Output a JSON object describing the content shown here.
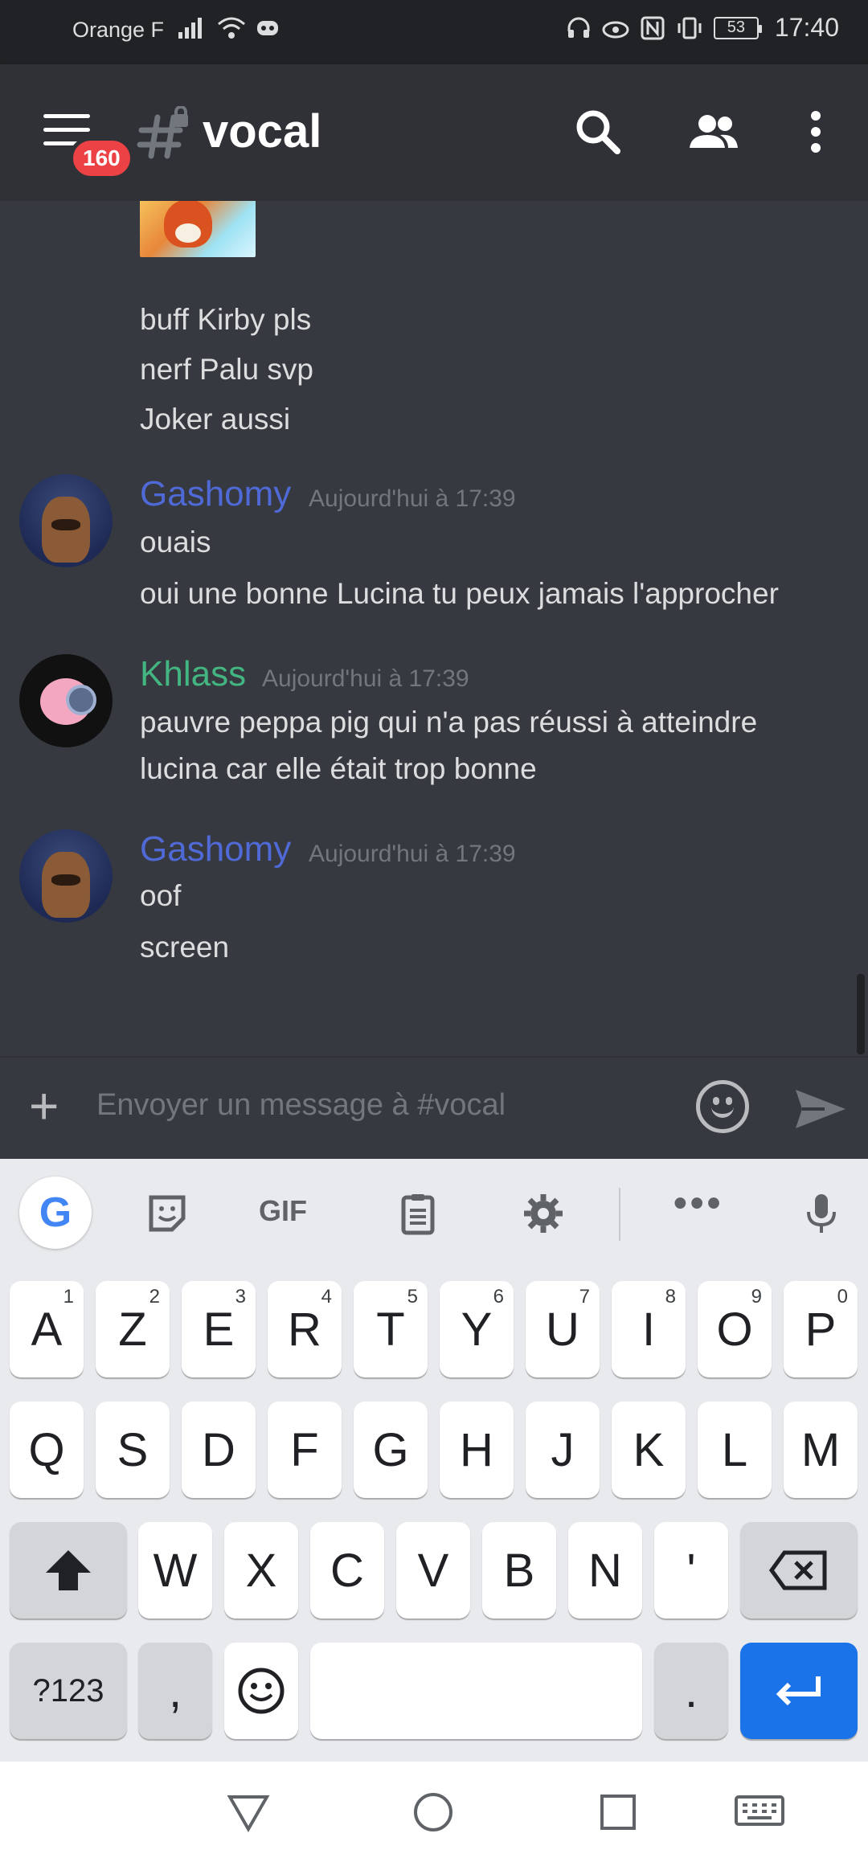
{
  "status_bar": {
    "carrier": "Orange F",
    "battery": "53",
    "time": "17:40"
  },
  "header": {
    "menu_badge": "160",
    "channel_name": "vocal"
  },
  "messages": {
    "continued_lines": [
      "buff Kirby pls",
      "nerf Palu svp",
      "Joker aussi"
    ],
    "groups": [
      {
        "author": "Gashomy",
        "timestamp": "Aujourd'hui à 17:39",
        "lines": [
          "ouais",
          "oui une bonne Lucina tu peux jamais l'approcher"
        ]
      },
      {
        "author": "Khlass",
        "timestamp": "Aujourd'hui à 17:39",
        "lines": [
          "pauvre peppa pig qui n'a pas réussi à atteindre",
          "lucina car elle était trop bonne"
        ]
      },
      {
        "author": "Gashomy",
        "timestamp": "Aujourd'hui à 17:39",
        "lines": [
          "oof",
          "screen"
        ]
      }
    ]
  },
  "input": {
    "placeholder": "Envoyer un message à #vocal"
  },
  "keyboard": {
    "toolbar": {
      "google": "G",
      "gif": "GIF",
      "more": "•••"
    },
    "row1": [
      {
        "k": "A",
        "h": "1"
      },
      {
        "k": "Z",
        "h": "2"
      },
      {
        "k": "E",
        "h": "3"
      },
      {
        "k": "R",
        "h": "4"
      },
      {
        "k": "T",
        "h": "5"
      },
      {
        "k": "Y",
        "h": "6"
      },
      {
        "k": "U",
        "h": "7"
      },
      {
        "k": "I",
        "h": "8"
      },
      {
        "k": "O",
        "h": "9"
      },
      {
        "k": "P",
        "h": "0"
      }
    ],
    "row2": [
      "Q",
      "S",
      "D",
      "F",
      "G",
      "H",
      "J",
      "K",
      "L",
      "M"
    ],
    "row3": [
      "W",
      "X",
      "C",
      "V",
      "B",
      "N",
      "'"
    ],
    "row4": {
      "symbols": "?123",
      "comma": ",",
      "period": "."
    }
  },
  "colors": {
    "gashomy": "#4f6ad6",
    "khlass": "#43b581",
    "badge": "#ed4245",
    "enter_key": "#1a73e8"
  }
}
